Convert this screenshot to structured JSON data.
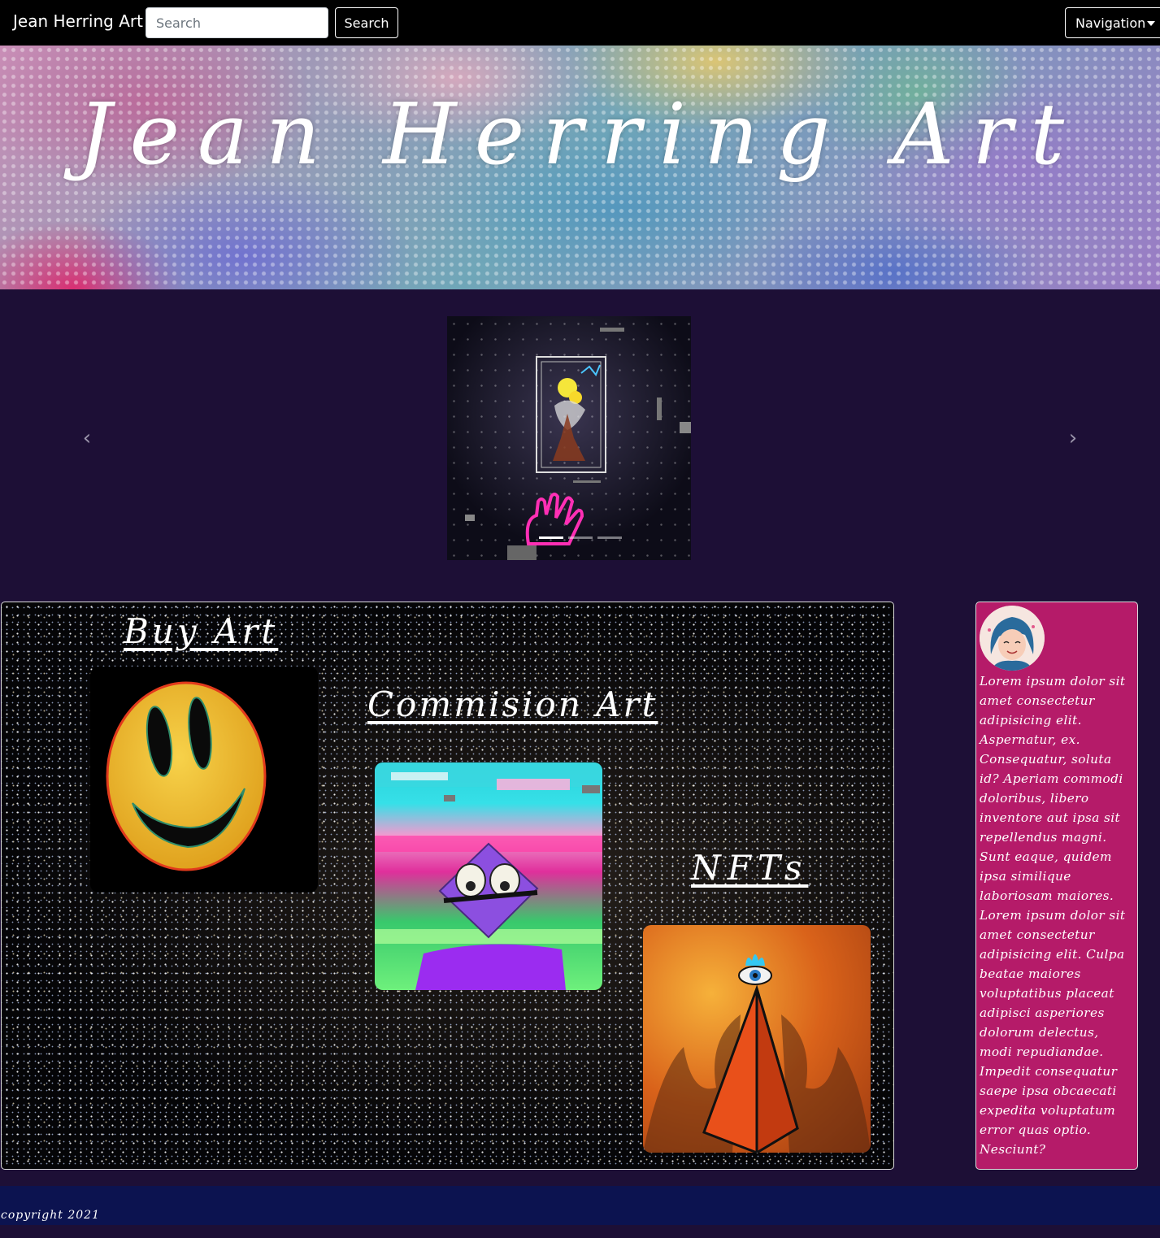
{
  "navbar": {
    "brand": "Jean Herring Art",
    "search_placeholder": "Search",
    "search_button": "Search",
    "navigation_label": "Navigation"
  },
  "banner": {
    "title": "Jean Herring Art"
  },
  "carousel": {
    "prev_icon": "chevron-left-icon",
    "next_icon": "chevron-right-icon",
    "slide_count": 3,
    "active_slide": 1
  },
  "gallery": {
    "buy_heading": "Buy Art",
    "commission_heading": "Commision Art",
    "nfts_heading": "NFTs"
  },
  "sidebar": {
    "bio": "Lorem ipsum dolor sit amet consectetur adipisicing elit. Aspernatur, ex. Consequatur, soluta id? Aperiam commodi doloribus, libero inventore aut ipsa sit repellendus magni. Sunt eaque, quidem ipsa similique laboriosam maiores. Lorem ipsum dolor sit amet consectetur adipisicing elit. Culpa beatae maiores voluptatibus placeat adipisci asperiores dolorum delectus, modi repudiandae. Impedit consequatur saepe ipsa obcaecati expedita voluptatum error quas optio. Nesciunt?"
  },
  "footer": {
    "copyright": "copyright 2021"
  },
  "colors": {
    "page_background": "#1d0f36",
    "sidebar_background": "#b51b69",
    "footer_background": "#0c1350",
    "navbar_background": "#000000"
  }
}
